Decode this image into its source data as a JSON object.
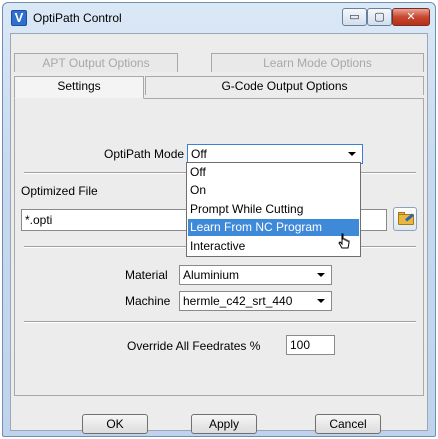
{
  "window": {
    "title": "OptiPath Control",
    "buttons": {
      "minimize": "▭",
      "maximize": "▢",
      "close": "✕"
    }
  },
  "tabs": {
    "row1": [
      "APT Output Options",
      "Learn Mode Options"
    ],
    "row2": [
      "Settings",
      "G-Code Output Options"
    ]
  },
  "settings": {
    "optipath_mode_label": "OptiPath Mode",
    "optipath_mode_value": "Off",
    "optimized_file_label": "Optimized File",
    "optimized_file_value": "*.opti",
    "material_label": "Material",
    "material_value": "Aluminium",
    "machine_label": "Machine",
    "machine_value": "hermle_c42_srt_440",
    "override_label": "Override All Feedrates %",
    "override_value": "100"
  },
  "dropdown": {
    "options": [
      "Off",
      "On",
      "Prompt While Cutting",
      "Learn From NC Program",
      "Interactive"
    ],
    "highlighted": "Learn From NC Program"
  },
  "footer": {
    "ok": "OK",
    "apply": "Apply",
    "cancel": "Cancel"
  },
  "colors": {
    "highlight": "#3f89d9",
    "close_button": "#c9462f",
    "accent": "#2f6fd0"
  }
}
